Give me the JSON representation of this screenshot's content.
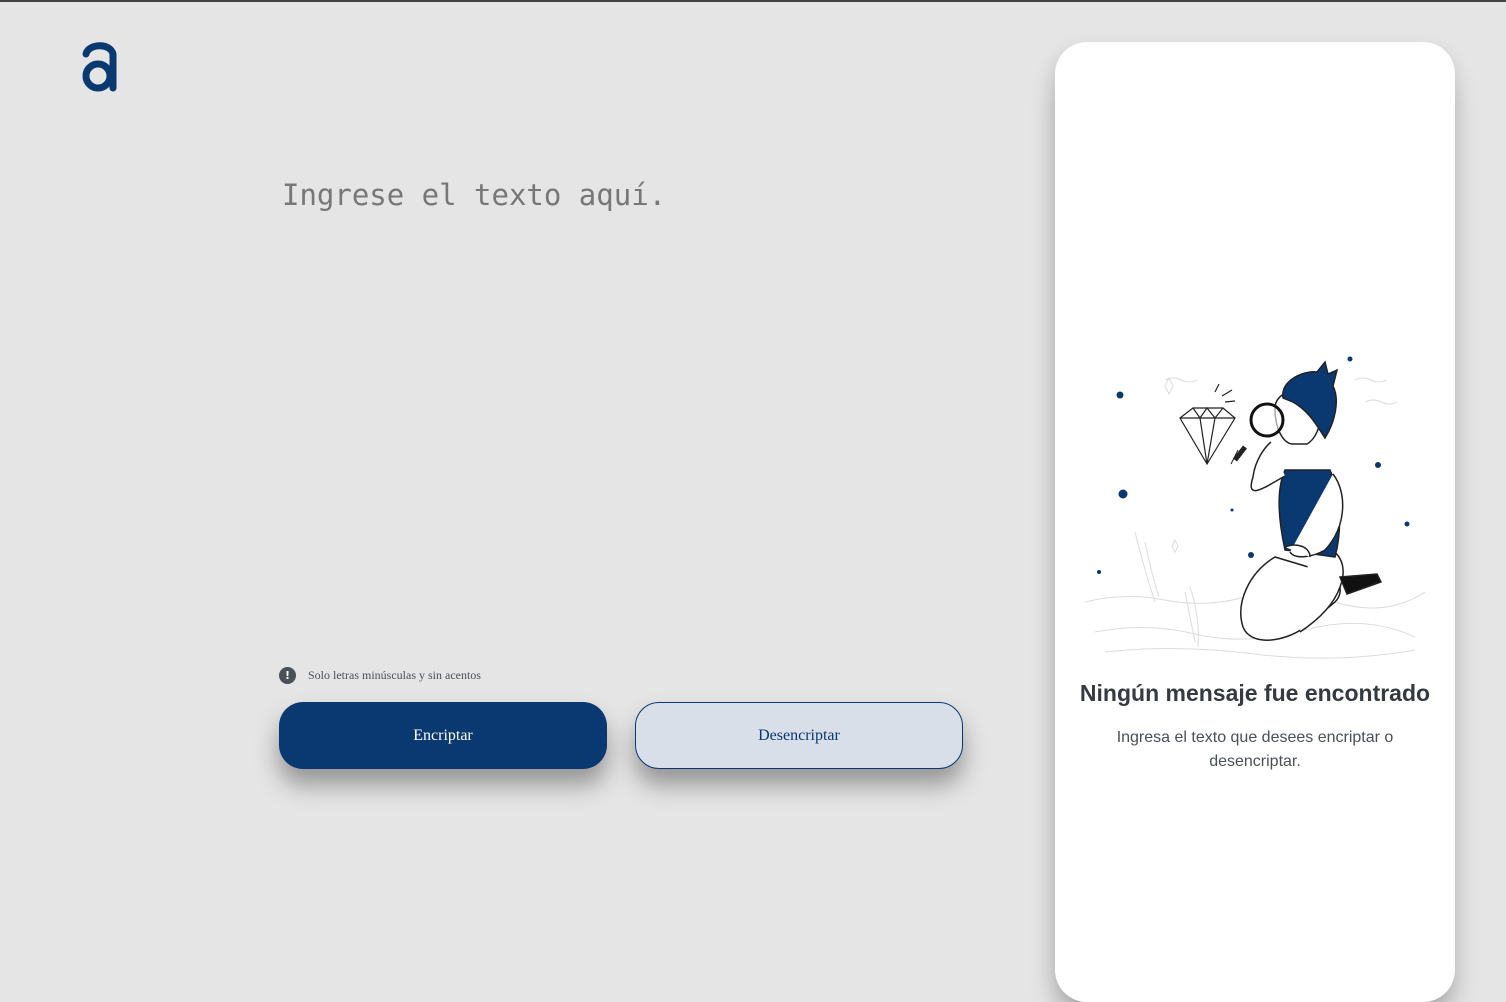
{
  "brand": {
    "logo_icon": "alura-a-logo-icon",
    "color": "#0a3871"
  },
  "input": {
    "placeholder": "Ingrese el texto aquí.",
    "value": ""
  },
  "hint": {
    "icon": "exclamation-circle-icon",
    "text": "Solo letras minúsculas y sin acentos"
  },
  "buttons": {
    "encrypt_label": "Encriptar",
    "decrypt_label": "Desencriptar"
  },
  "output": {
    "illustration": "person-searching-diamond-illustration",
    "empty_title": "Ningún mensaje fue encontrado",
    "empty_description": "Ingresa el texto que desees encriptar o desencriptar."
  },
  "colors": {
    "background": "#e5e5e5",
    "primary": "#0a3871",
    "secondary_button": "#d8dfe8",
    "panel": "#ffffff"
  }
}
